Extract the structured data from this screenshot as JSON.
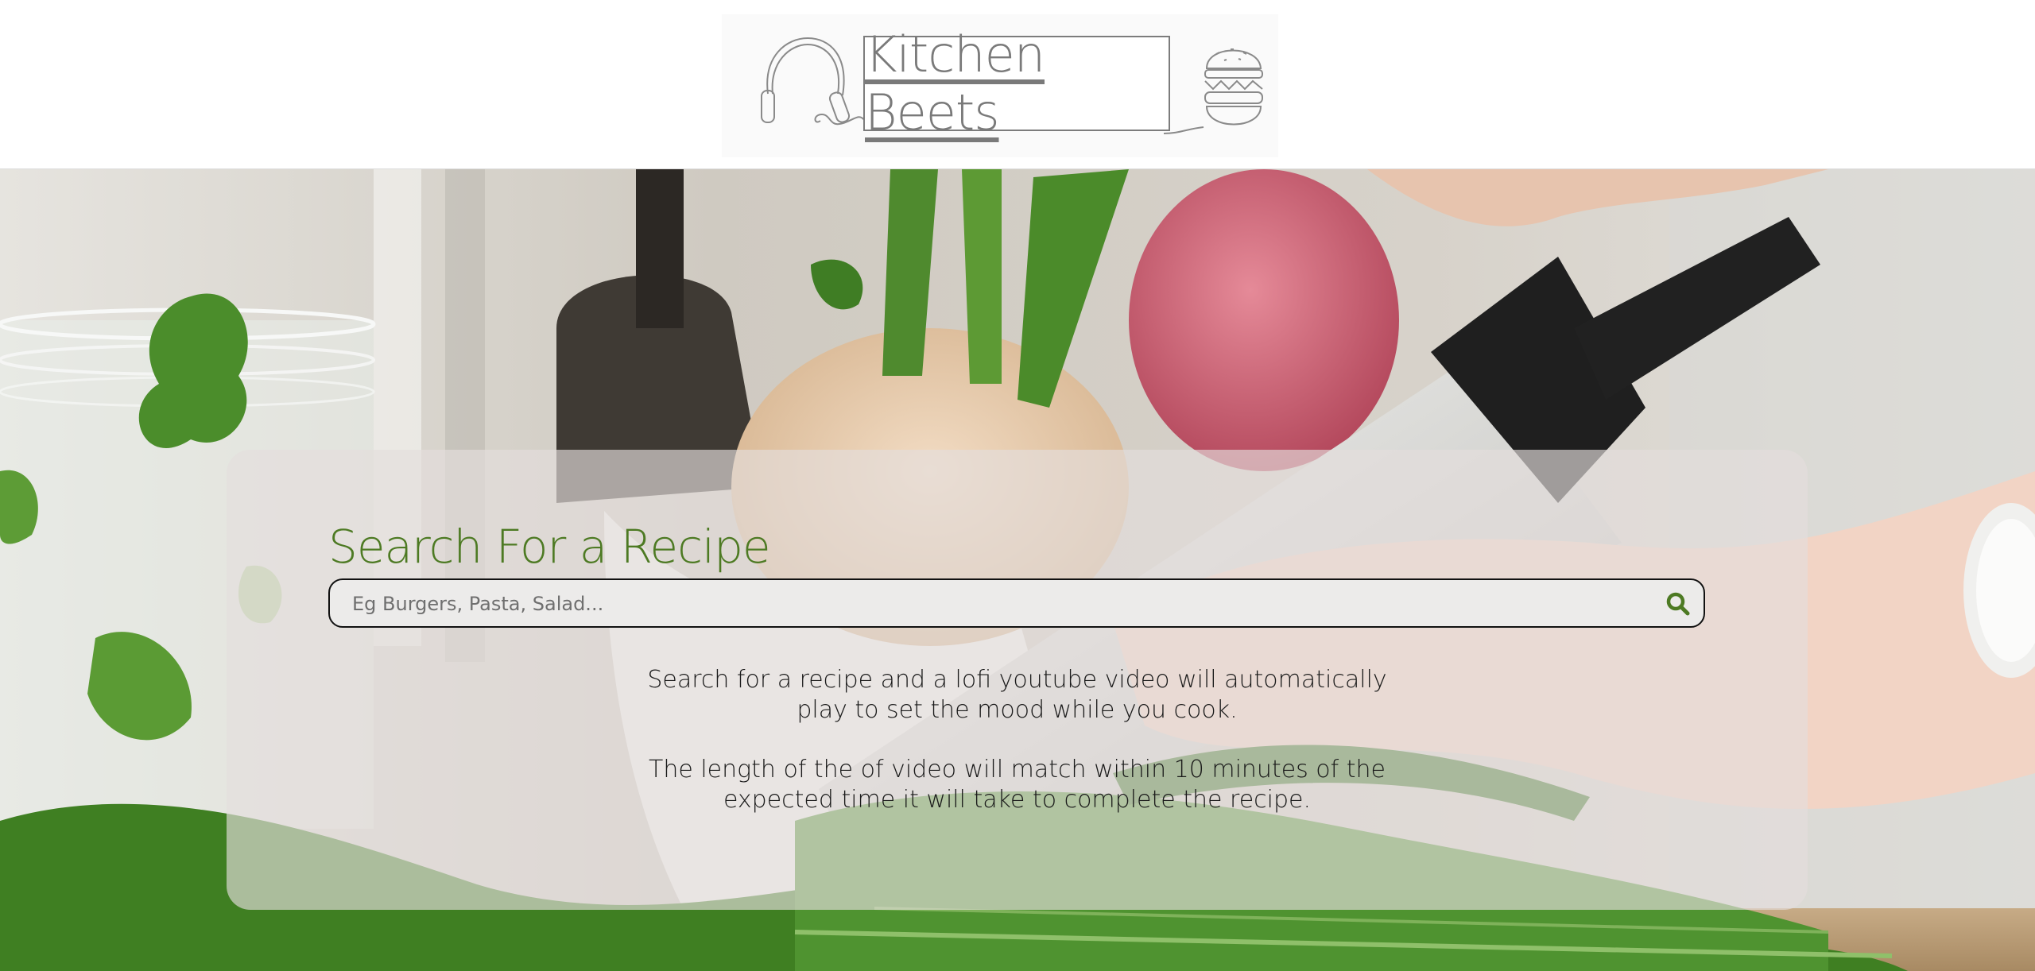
{
  "header": {
    "logo_text": "Kitchen Beets",
    "icons": [
      "headphones-icon",
      "burger-icon"
    ]
  },
  "search": {
    "title": "Search For a Recipe",
    "placeholder": "Eg Burgers, Pasta, Salad...",
    "value": "",
    "button_icon": "search-icon"
  },
  "description": {
    "p1_line1": "Search for a recipe and a lofi youtube video will automatically",
    "p1_line2": "play to set the mood while you cook.",
    "p2_line1": "The length of the of video will match within 10 minutes of the",
    "p2_line2": "expected time it will take to complete the recipe."
  },
  "colors": {
    "accent_green": "#4d7a23",
    "logo_gray": "#7a7a7a",
    "panel_bg": "rgba(228,222,220,0.66)"
  }
}
